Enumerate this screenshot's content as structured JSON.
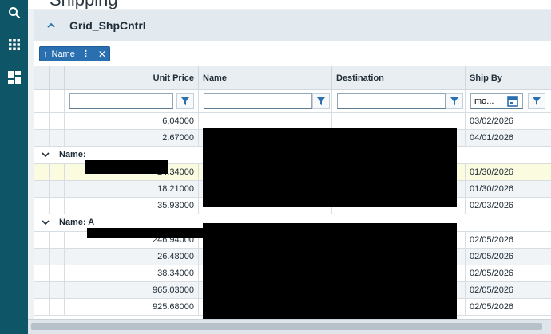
{
  "app": {
    "page_title": "Shipping"
  },
  "panel": {
    "title": "Grid_ShpCntrl"
  },
  "group_chip": {
    "label": "Name",
    "arrow": "↑",
    "menu": "⋮",
    "remove": "✕"
  },
  "columns": {
    "unit_price": "Unit Price",
    "name": "Name",
    "destination": "Destination",
    "ship_by": "Ship By"
  },
  "filters": {
    "ship_by_value": "mo..."
  },
  "rows_group0": [
    {
      "price": "6.04000",
      "ship_by": "03/02/2026"
    },
    {
      "price": "2.67000",
      "ship_by": "04/01/2026"
    }
  ],
  "group1": {
    "label": "Name:"
  },
  "rows_group1": [
    {
      "price": "24.34000",
      "ship_by": "01/30/2026"
    },
    {
      "price": "18.21000",
      "ship_by": "01/30/2026"
    },
    {
      "price": "35.93000",
      "ship_by": "02/03/2026"
    }
  ],
  "group2": {
    "label": "Name: A"
  },
  "rows_group2": [
    {
      "price": "246.94000",
      "ship_by": "02/05/2026"
    },
    {
      "price": "26.48000",
      "ship_by": "02/05/2026"
    },
    {
      "price": "38.34000",
      "ship_by": "02/05/2026"
    },
    {
      "price": "965.03000",
      "ship_by": "02/05/2026"
    },
    {
      "price": "925.68000",
      "ship_by": "02/05/2026"
    }
  ],
  "colors": {
    "rail": "#0f5568",
    "accent": "#2a6fb0",
    "header_bg": "#e2eaf0",
    "highlight": "#fbfbe0"
  },
  "icons": {
    "rail": [
      "search-icon",
      "grid-apps-icon",
      "dashboard-icon"
    ],
    "filter": "funnel-icon",
    "calendar": "calendar-icon"
  }
}
